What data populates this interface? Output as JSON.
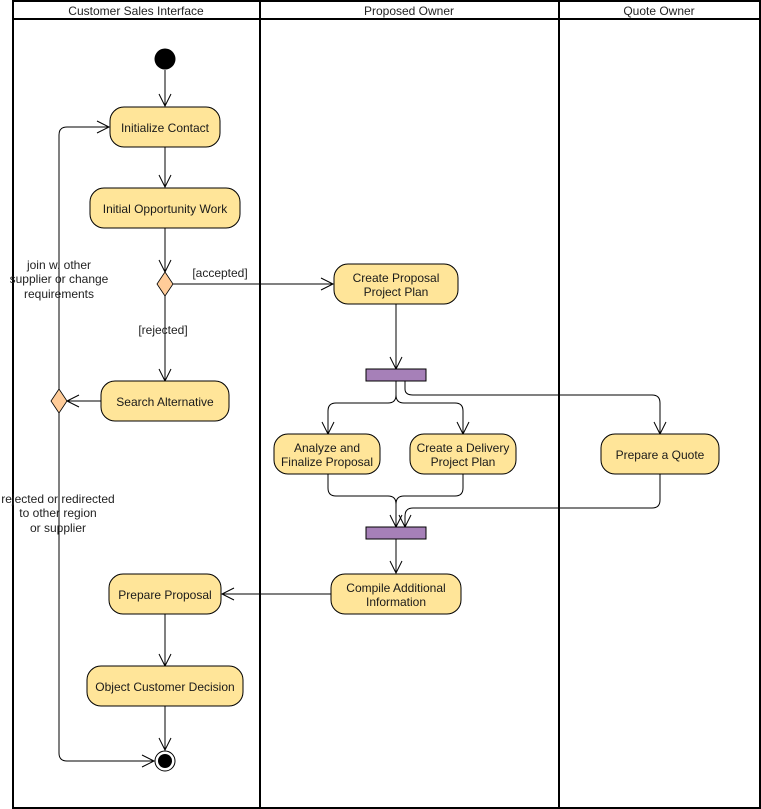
{
  "colors": {
    "action_fill": "#ffe599",
    "decision_fill": "#ffcc99",
    "bar_fill": "#a680b8",
    "line": "#000000"
  },
  "lanes": [
    {
      "title": "Customer Sales Interface"
    },
    {
      "title": "Proposed Owner"
    },
    {
      "title": "Quote Owner"
    }
  ],
  "nodes": {
    "initialize_contact": {
      "label": [
        "Initialize Contact"
      ]
    },
    "initial_opportunity_work": {
      "label": [
        "Initial Opportunity Work"
      ]
    },
    "create_proposal_project_plan": {
      "label": [
        "Create Proposal",
        "Project Plan"
      ]
    },
    "search_alternative": {
      "label": [
        "Search Alternative"
      ]
    },
    "analyze_finalize_proposal": {
      "label": [
        "Analyze and",
        "Finalize Proposal"
      ]
    },
    "create_delivery_project_plan": {
      "label": [
        "Create a Delivery",
        "Project Plan"
      ]
    },
    "prepare_quote": {
      "label": [
        "Prepare a Quote"
      ]
    },
    "compile_additional_information": {
      "label": [
        "Compile Additional",
        "Information"
      ]
    },
    "prepare_proposal": {
      "label": [
        "Prepare Proposal"
      ]
    },
    "object_customer_decision": {
      "label": [
        "Object Customer Decision"
      ]
    }
  },
  "edge_labels": {
    "accepted": "[accepted]",
    "rejected": "[rejected]",
    "join_other_supplier": [
      "join w. other",
      "supplier or change",
      "requirements"
    ],
    "rejected_redirected": [
      "rejected or redirected",
      "to other region",
      "or supplier"
    ]
  }
}
